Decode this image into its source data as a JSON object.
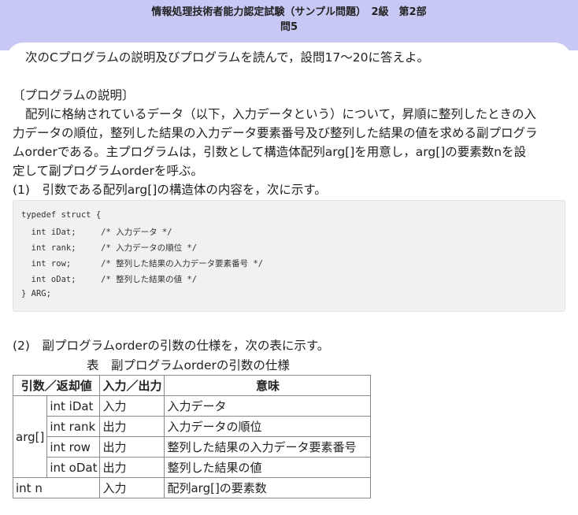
{
  "header": {
    "title": "情報処理技術者能力認定試験（サンプル問題）　2級　第2部",
    "question": "問5"
  },
  "intro": "次のCプログラムの説明及びプログラムを読んで，設問17～20に答えよ。",
  "program_desc": {
    "heading": "〔プログラムの説明〕",
    "lines": [
      "配列に格納されているデータ（以下，入力データという）について，昇順に整列したときの入",
      "力データの順位，整列した結果の入力データ要素番号及び整列した結果の値を求める副プログラ",
      "ムorderである。主プログラムは，引数として構造体配列arg[]を用意し，arg[]の要素数nを設",
      "定して副プログラムorderを呼ぶ。"
    ]
  },
  "item1": "(1)　引数である配列arg[]の構造体の内容を，次に示す。",
  "code": {
    "lines": [
      "typedef struct {",
      "  int iDat;     /* 入力データ */",
      "  int rank;     /* 入力データの順位 */",
      "  int row;      /* 整列した結果の入力データ要素番号 */",
      "  int oDat;     /* 整列した結果の値 */",
      "} ARG;"
    ]
  },
  "item2": "(2)　副プログラムorderの引数の仕様を，次の表に示す。",
  "table": {
    "caption": "表　副プログラムorderの引数の仕様",
    "headers": [
      "引数／返却値",
      "入力／出力",
      "意味"
    ],
    "group": "arg[]",
    "rows": [
      {
        "member": "int iDat",
        "io": "入力",
        "meaning": "入力データ"
      },
      {
        "member": "int rank",
        "io": "出力",
        "meaning": "入力データの順位"
      },
      {
        "member": "int row",
        "io": "出力",
        "meaning": "整列した結果の入力データ要素番号"
      },
      {
        "member": "int oDat",
        "io": "出力",
        "meaning": "整列した結果の値"
      }
    ],
    "last_row": {
      "name": "int n",
      "io": "入力",
      "meaning": "配列arg[]の要素数"
    }
  }
}
